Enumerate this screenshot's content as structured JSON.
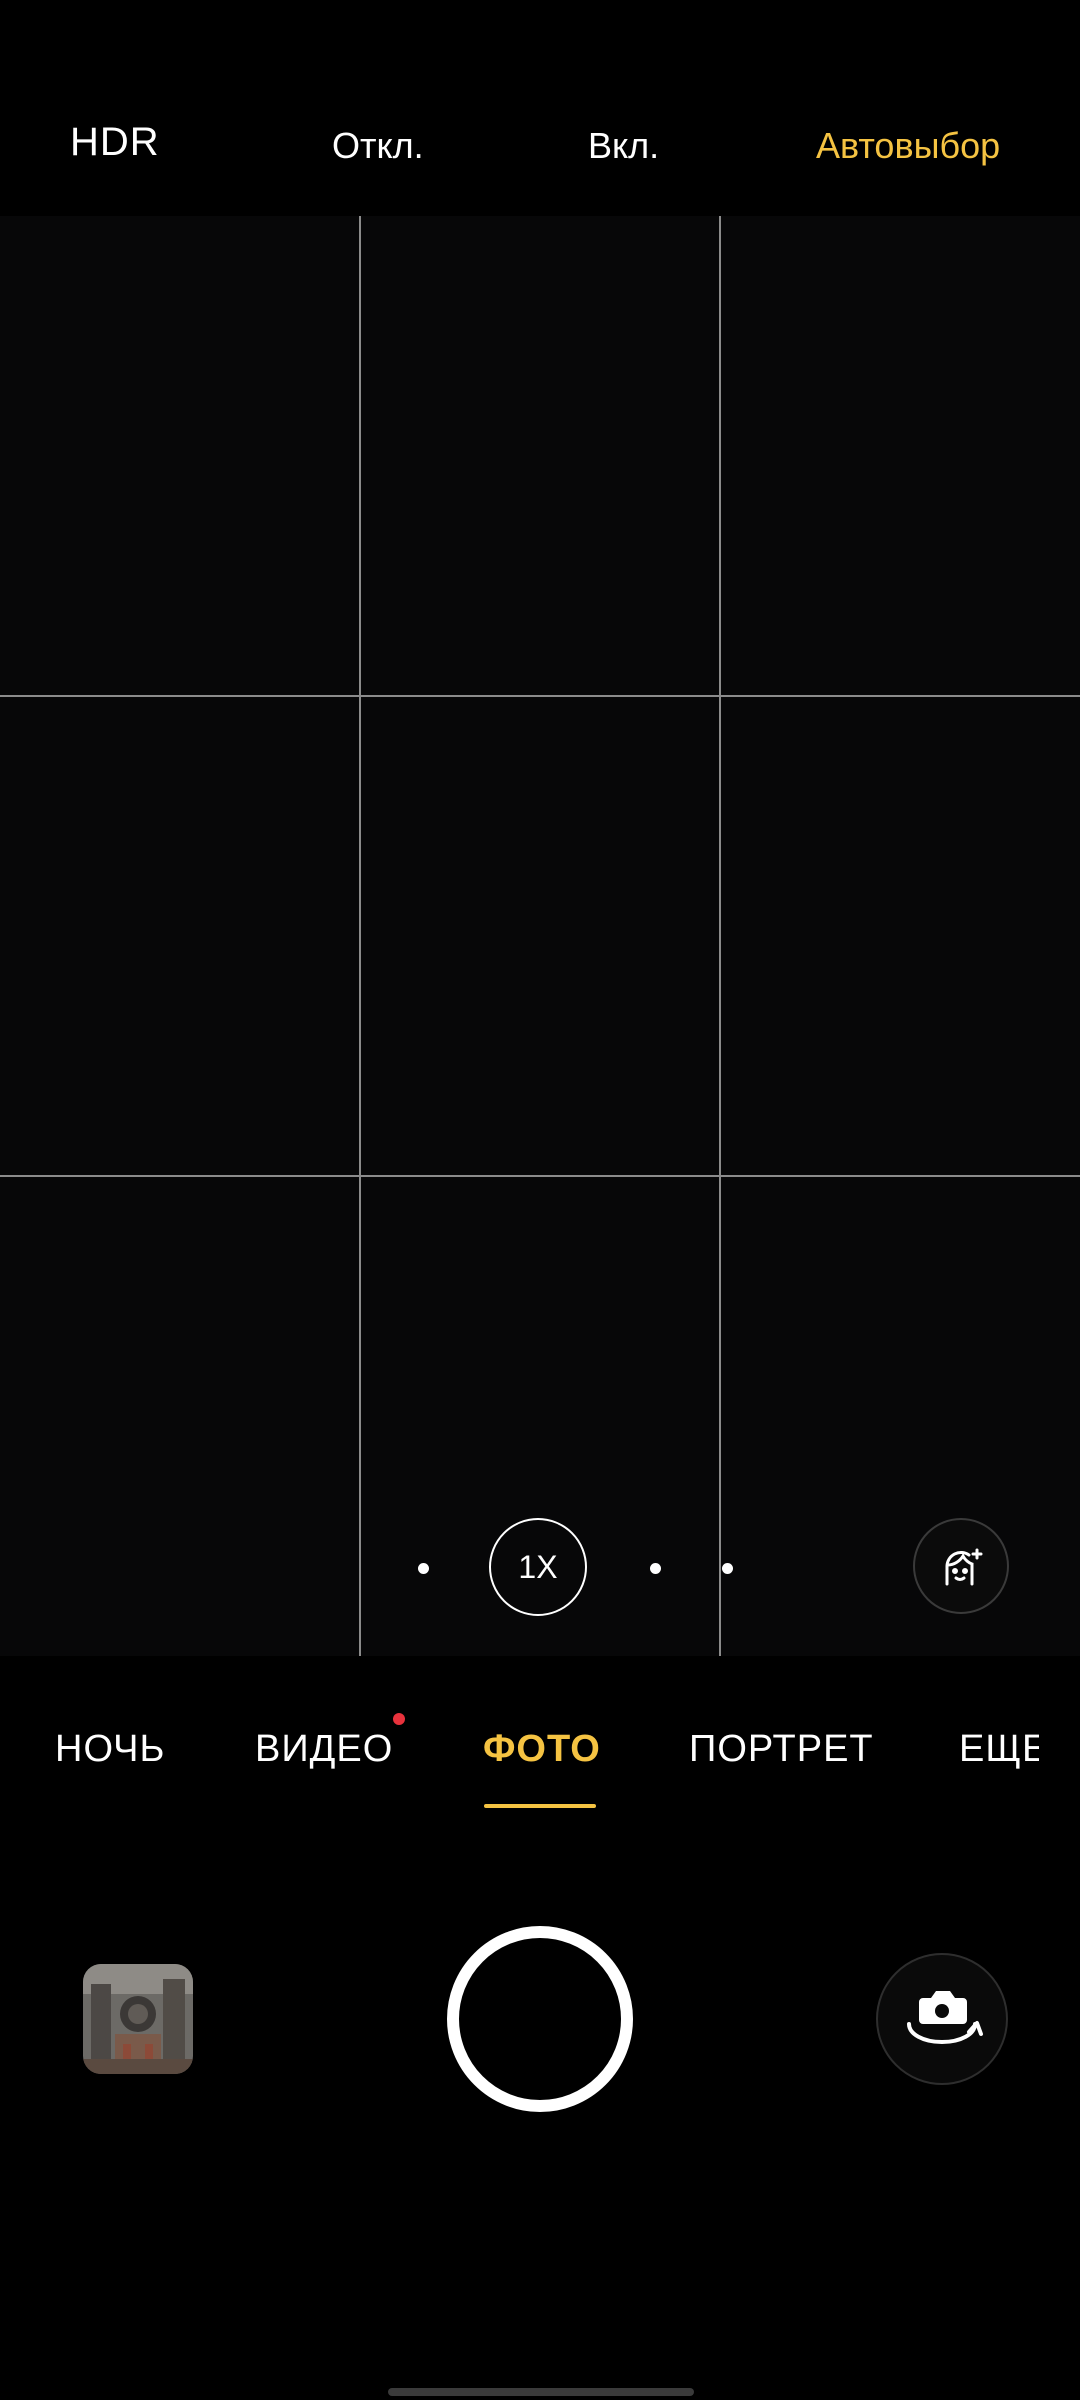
{
  "hdr": {
    "title": "HDR",
    "options": [
      "Откл.",
      "Вкл.",
      "Автовыбор"
    ],
    "selected": "Автовыбор"
  },
  "zoom": {
    "label": "1X"
  },
  "modes": {
    "items": [
      "НОЧЬ",
      "ВИДЕО",
      "ФОТО",
      "ПОРТРЕТ",
      "ЕЩЕ"
    ],
    "selected": "ФОТО"
  },
  "icons": {
    "beauty": "beauty-face-icon",
    "switch_camera": "switch-camera-icon"
  },
  "colors": {
    "accent": "#f5c342",
    "notification_dot": "#e8323c"
  }
}
